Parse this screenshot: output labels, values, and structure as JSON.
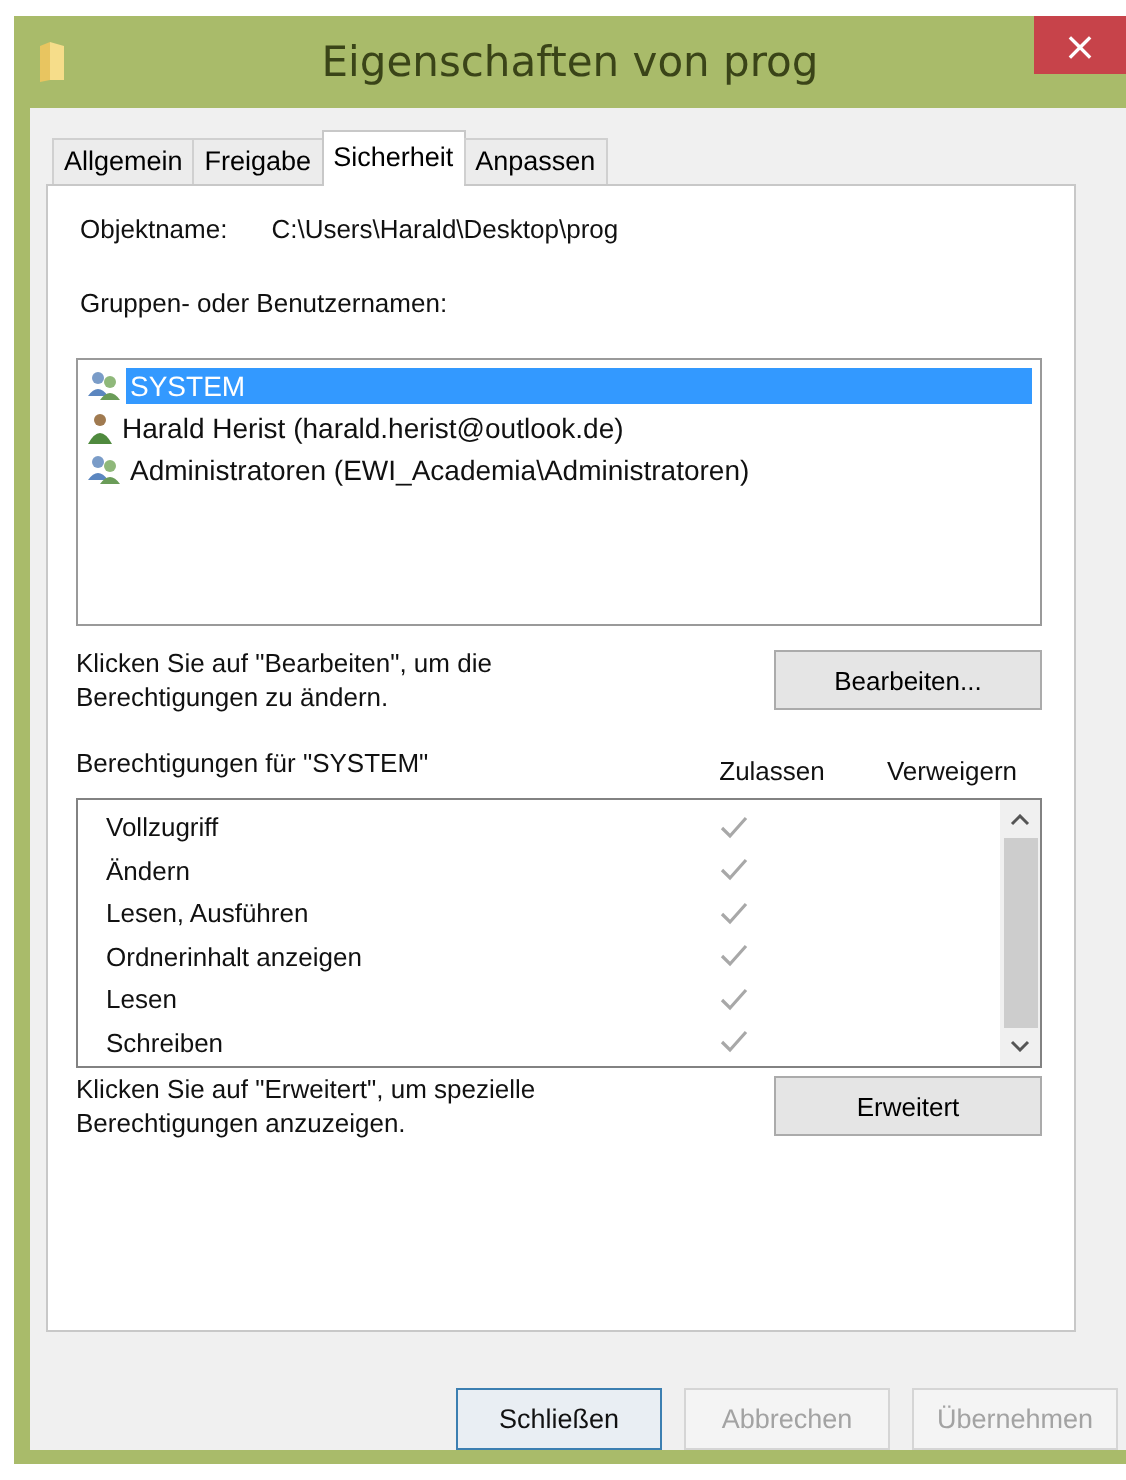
{
  "window": {
    "title": "Eigenschaften von prog",
    "close": "×"
  },
  "tabs": [
    {
      "label": "Allgemein",
      "selected": false
    },
    {
      "label": "Freigabe",
      "selected": false
    },
    {
      "label": "Sicherheit",
      "selected": true
    },
    {
      "label": "Anpassen",
      "selected": false
    }
  ],
  "object": {
    "label": "Objektname:",
    "value": "C:\\Users\\Harald\\Desktop\\prog"
  },
  "groups": {
    "label": "Gruppen- oder Benutzernamen:",
    "items": [
      {
        "name": "SYSTEM",
        "kind": "group",
        "selected": true
      },
      {
        "name": "Harald Herist (harald.herist@outlook.de)",
        "kind": "user",
        "selected": false
      },
      {
        "name": "Administratoren (EWI_Academia\\Administratoren)",
        "kind": "group",
        "selected": false
      }
    ]
  },
  "edit_hint": "Klicken Sie auf \"Bearbeiten\", um die Berechtigungen zu ändern.",
  "edit_button": "Bearbeiten...",
  "permissions": {
    "label": "Berechtigungen für \"SYSTEM\"",
    "allow_header": "Zulassen",
    "deny_header": "Verweigern",
    "rows": [
      {
        "name": "Vollzugriff",
        "allow": true,
        "deny": false
      },
      {
        "name": "Ändern",
        "allow": true,
        "deny": false
      },
      {
        "name": "Lesen, Ausführen",
        "allow": true,
        "deny": false
      },
      {
        "name": "Ordnerinhalt anzeigen",
        "allow": true,
        "deny": false
      },
      {
        "name": "Lesen",
        "allow": true,
        "deny": false
      },
      {
        "name": "Schreiben",
        "allow": true,
        "deny": false
      }
    ]
  },
  "advanced_hint": "Klicken Sie auf \"Erweitert\", um spezielle Berechtigungen anzuzeigen.",
  "advanced_button": "Erweitert",
  "buttons": [
    {
      "label": "Schließen",
      "disabled": false
    },
    {
      "label": "Abbrechen",
      "disabled": true
    },
    {
      "label": "Übernehmen",
      "disabled": true
    }
  ]
}
